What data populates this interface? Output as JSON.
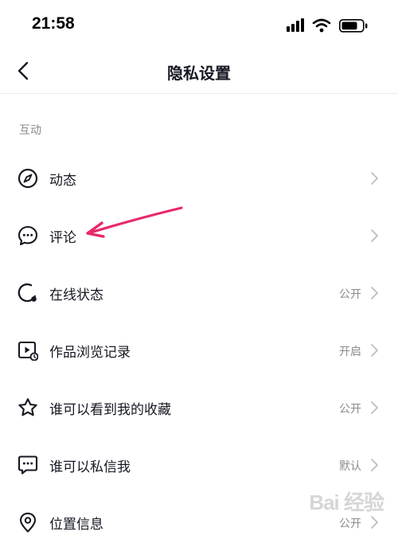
{
  "status_bar": {
    "time": "21:58"
  },
  "header": {
    "title": "隐私设置"
  },
  "section": {
    "title": "互动"
  },
  "items": [
    {
      "label": "动态",
      "value": "",
      "icon": "compass-icon"
    },
    {
      "label": "评论",
      "value": "",
      "icon": "comment-bubble-icon"
    },
    {
      "label": "在线状态",
      "value": "公开",
      "icon": "online-status-icon"
    },
    {
      "label": "作品浏览记录",
      "value": "开启",
      "icon": "video-history-icon"
    },
    {
      "label": "谁可以看到我的收藏",
      "value": "公开",
      "icon": "star-icon"
    },
    {
      "label": "谁可以私信我",
      "value": "默认",
      "icon": "message-icon"
    },
    {
      "label": "位置信息",
      "value": "公开",
      "icon": "location-pin-icon"
    }
  ],
  "watermark": {
    "text": "Bai 经验"
  },
  "colors": {
    "annotation_arrow": "#e8286e",
    "secondary_text": "#8a8b91",
    "primary_text": "#161823"
  }
}
